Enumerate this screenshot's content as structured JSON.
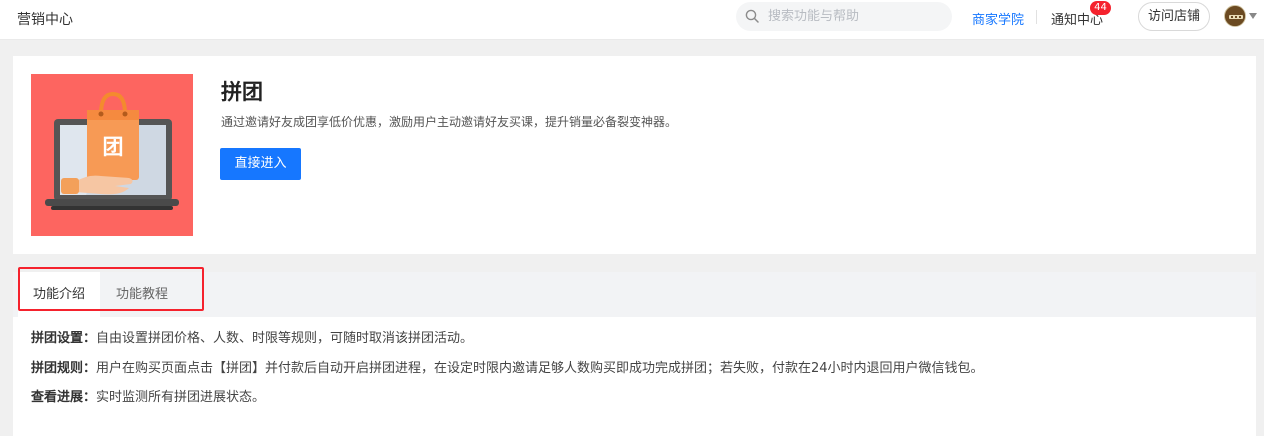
{
  "header": {
    "title": "营销中心",
    "search_placeholder": "搜索功能与帮助",
    "academy_link": "商家学院",
    "notice_label": "通知中心",
    "notice_count": "44",
    "visit_store_label": "访问店铺"
  },
  "feature": {
    "title": "拼团",
    "description": "通过邀请好友成团享低价优惠，激励用户主动邀请好友买课，提升销量必备裂变神器。",
    "enter_button": "直接进入",
    "hero_glyph": "团"
  },
  "tabs": [
    {
      "label": "功能介绍",
      "active": true
    },
    {
      "label": "功能教程",
      "active": false
    }
  ],
  "intro": [
    {
      "key": "拼团设置：",
      "text": "自由设置拼团价格、人数、时限等规则，可随时取消该拼团活动。"
    },
    {
      "key": "拼团规则：",
      "text": "用户在购买页面点击【拼团】并付款后自动开启拼团进程，在设定时限内邀请足够人数购买即成功完成拼团；若失败，付款在24小时内退回用户微信钱包。"
    },
    {
      "key": "查看进展：",
      "text": "实时监测所有拼团进展状态。"
    }
  ],
  "colors": {
    "accent": "#1677ff",
    "badge": "#f5222d",
    "hero_bg": "#fd6560",
    "highlight": "#f5222d"
  },
  "icons": [
    "search-icon",
    "avatar",
    "chevron-down-icon",
    "shopping-bag-icon",
    "laptop-icon",
    "hand-icon"
  ]
}
